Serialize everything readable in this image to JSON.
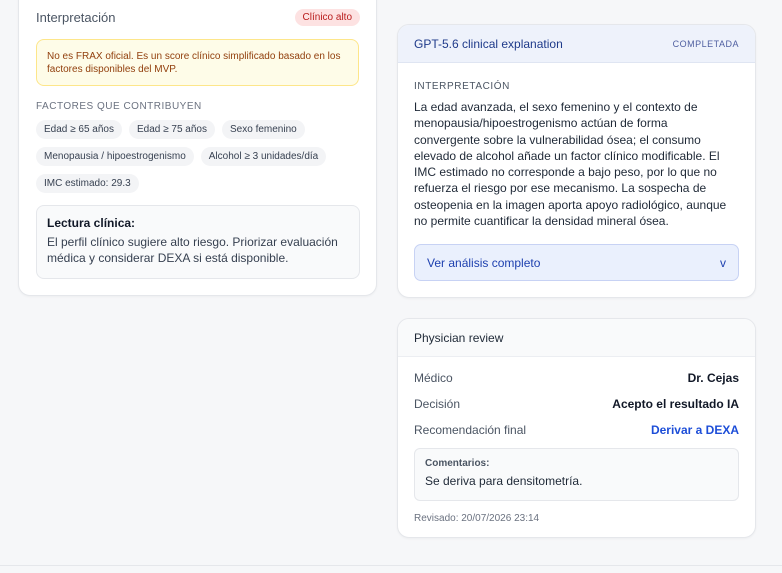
{
  "left": {
    "interpretation_title": "Interpretación",
    "risk_badge": "Clínico alto",
    "warning": "No es FRAX oficial. Es un score clínico simplificado basado en los factores disponibles del MVP.",
    "factors_title": "FACTORES QUE CONTRIBUYEN",
    "factors": [
      "Edad ≥ 65 años",
      "Edad ≥ 75 años",
      "Sexo femenino",
      "Menopausia / hipoestrogenismo",
      "Alcohol ≥ 3 unidades/día",
      "IMC estimado: 29.3"
    ],
    "reading_title": "Lectura clínica:",
    "reading_text": "El perfil clínico sugiere alto riesgo. Priorizar evaluación médica y considerar DEXA si está disponible."
  },
  "gpt": {
    "title": "GPT-5.6 clinical explanation",
    "status": "COMPLETADA",
    "interp_label": "INTERPRETACIÓN",
    "interp_text": "La edad avanzada, el sexo femenino y el contexto de menopausia/hipoestrogenismo actúan de forma convergente sobre la vulnerabilidad ósea; el consumo elevado de alcohol añade un factor clínico modificable. El IMC estimado no corresponde a bajo peso, por lo que no refuerza el riesgo por ese mecanismo. La sospecha de osteopenia en la imagen aporta apoyo radiológico, aunque no permite cuantificar la densidad mineral ósea.",
    "expand_label": "Ver análisis completo",
    "expand_icon": "v"
  },
  "physician": {
    "title": "Physician review",
    "doctor_label": "Médico",
    "doctor_value": "Dr. Cejas",
    "decision_label": "Decisión",
    "decision_value": "Acepto el resultado IA",
    "recommendation_label": "Recomendación final",
    "recommendation_value": "Derivar a DEXA",
    "comments_label": "Comentarios:",
    "comments_text": "Se deriva para densitometría.",
    "reviewed": "Revisado: 20/07/2026 23:14"
  }
}
